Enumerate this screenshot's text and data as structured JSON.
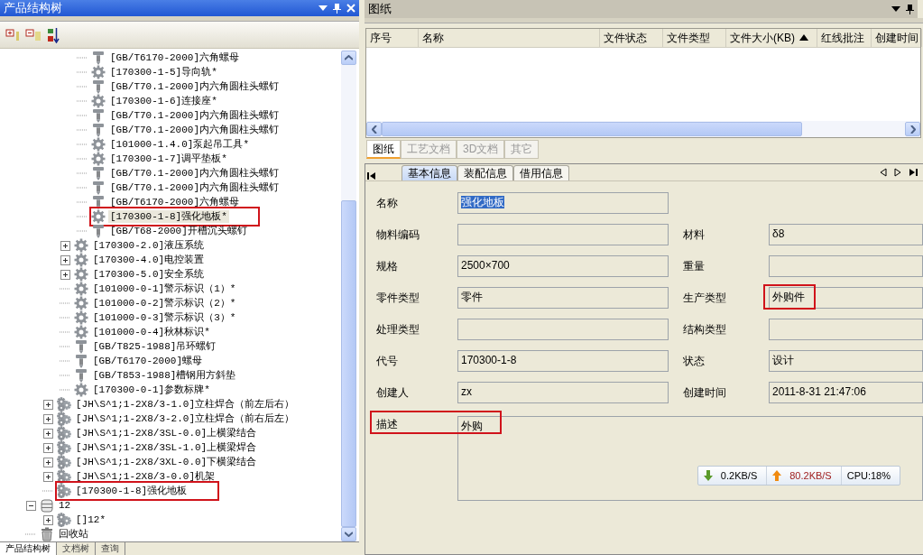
{
  "tree_panel": {
    "title": "产品结构树",
    "tree": [
      {
        "children": [
          {
            "children": [
              {
                "children": [
                  {
                    "label": "[GB/T6170-2000]六角螺母",
                    "kind": "standard",
                    "selected": false,
                    "annotated": false
                  },
                  {
                    "label": "[170300-1-5]导向轨*",
                    "kind": "part",
                    "selected": false,
                    "annotated": false
                  },
                  {
                    "label": "[GB/T70.1-2000]内六角圆柱头螺钉",
                    "kind": "standard",
                    "selected": false,
                    "annotated": false
                  },
                  {
                    "label": "[170300-1-6]连接座*",
                    "kind": "part",
                    "selected": false,
                    "annotated": false
                  },
                  {
                    "label": "[GB/T70.1-2000]内六角圆柱头螺钉",
                    "kind": "standard",
                    "selected": false,
                    "annotated": false
                  },
                  {
                    "label": "[GB/T70.1-2000]内六角圆柱头螺钉",
                    "kind": "standard",
                    "selected": false,
                    "annotated": false
                  },
                  {
                    "label": "[101000-1.4.0]泵起吊工具*",
                    "kind": "part",
                    "selected": false,
                    "annotated": false
                  },
                  {
                    "label": "[170300-1-7]调平垫板*",
                    "kind": "part",
                    "selected": false,
                    "annotated": false
                  },
                  {
                    "label": "[GB/T70.1-2000]内六角圆柱头螺钉",
                    "kind": "standard",
                    "selected": false,
                    "annotated": false
                  },
                  {
                    "label": "[GB/T70.1-2000]内六角圆柱头螺钉",
                    "kind": "standard",
                    "selected": false,
                    "annotated": false
                  },
                  {
                    "label": "[GB/T6170-2000]六角螺母",
                    "kind": "standard",
                    "selected": false,
                    "annotated": false
                  },
                  {
                    "label": "[170300-1-8]强化地板*",
                    "kind": "part",
                    "selected": true,
                    "annotated": true
                  },
                  {
                    "label": "[GB/T68-2000]开槽沉头螺钉",
                    "kind": "standard",
                    "selected": false,
                    "annotated": false
                  }
                ]
              },
              {
                "label": "[170300-2.0]液压系统",
                "kind": "part",
                "expanded": false,
                "selected": false,
                "annotated": false
              },
              {
                "label": "[170300-4.0]电控装置",
                "kind": "part",
                "expanded": false,
                "selected": false,
                "annotated": false
              },
              {
                "label": "[170300-5.0]安全系统",
                "kind": "part",
                "expanded": false,
                "selected": false,
                "annotated": false
              },
              {
                "label": "[101000-0-1]警示标识（1）*",
                "kind": "part",
                "selected": false,
                "annotated": false
              },
              {
                "label": "[101000-0-2]警示标识（2）*",
                "kind": "part",
                "selected": false,
                "annotated": false
              },
              {
                "label": "[101000-0-3]警示标识（3）*",
                "kind": "part",
                "selected": false,
                "annotated": false
              },
              {
                "label": "[101000-0-4]秋林标识*",
                "kind": "part",
                "selected": false,
                "annotated": false
              },
              {
                "label": "[GB/T825-1988]吊环螺钉",
                "kind": "standard",
                "selected": false,
                "annotated": false
              },
              {
                "label": "[GB/T6170-2000]螺母",
                "kind": "standard",
                "selected": false,
                "annotated": false
              },
              {
                "label": "[GB/T853-1988]槽钢用方斜垫",
                "kind": "standard",
                "selected": false,
                "annotated": false
              },
              {
                "label": "[170300-0-1]参数标牌*",
                "kind": "part",
                "selected": false,
                "annotated": false
              }
            ]
          },
          {
            "label": "[JH\\S^1;1-2X8/3-1.0]立柱焊合（前左后右）",
            "kind": "assembly",
            "expanded": false,
            "selected": false,
            "annotated": false
          },
          {
            "label": "[JH\\S^1;1-2X8/3-2.0]立柱焊合（前右后左）",
            "kind": "assembly",
            "expanded": false,
            "selected": false,
            "annotated": false
          },
          {
            "label": "[JH\\S^1;1-2X8/3SL-0.0]上横梁结合",
            "kind": "assembly",
            "expanded": false,
            "selected": false,
            "annotated": false
          },
          {
            "label": "[JH\\S^1;1-2X8/3SL-1.0]上横梁焊合",
            "kind": "assembly",
            "expanded": false,
            "selected": false,
            "annotated": false
          },
          {
            "label": "[JH\\S^1;1-2X8/3XL-0.0]下横梁结合",
            "kind": "assembly",
            "expanded": false,
            "selected": false,
            "annotated": false
          },
          {
            "label": "[JH\\S^1;1-2X8/3-0.0]机架",
            "kind": "assembly",
            "expanded": false,
            "selected": false,
            "annotated": false
          },
          {
            "label": "[170300-1-8]强化地板",
            "kind": "assembly",
            "selected": false,
            "annotated": true
          }
        ]
      },
      {
        "label": "12",
        "kind": "database",
        "expanded": true,
        "selected": false,
        "annotated": false,
        "children": [
          {
            "label": "[]12*",
            "kind": "assembly",
            "expanded": false,
            "selected": false,
            "annotated": false
          }
        ]
      },
      {
        "label": "回收站",
        "kind": "trash",
        "selected": false,
        "annotated": false
      }
    ],
    "bottom_tabs": [
      {
        "label": "产品结构树",
        "selected": true
      },
      {
        "label": "文档树",
        "selected": false
      },
      {
        "label": "查询",
        "selected": false
      }
    ]
  },
  "drawings_panel": {
    "title": "图纸",
    "columns": [
      {
        "label": "序号",
        "sorted": false
      },
      {
        "label": "名称",
        "sorted": false
      },
      {
        "label": "文件状态",
        "sorted": false
      },
      {
        "label": "文件类型",
        "sorted": false
      },
      {
        "label": "文件大小(KB)",
        "sorted": true
      },
      {
        "label": "红线批注",
        "sorted": false
      },
      {
        "label": "创建时间",
        "sorted": false
      }
    ],
    "tabs": [
      {
        "label": "图纸",
        "selected": true
      },
      {
        "label": "工艺文档",
        "selected": false
      },
      {
        "label": "3D文档",
        "selected": false
      },
      {
        "label": "其它",
        "selected": false
      }
    ]
  },
  "info_panel": {
    "tabs": [
      {
        "label": "基本信息",
        "selected": true
      },
      {
        "label": "装配信息",
        "selected": false
      },
      {
        "label": "借用信息",
        "selected": false
      }
    ],
    "rows": [
      [
        {
          "label": "名称",
          "value": "强化地板",
          "value_selected": true,
          "annotated": false
        }
      ],
      [
        {
          "label": "物料编码",
          "annotated": false
        },
        {
          "label": "材料",
          "value": "δ8",
          "value_selected": false,
          "annotated": false
        }
      ],
      [
        {
          "label": "规格",
          "value": "2500×700",
          "value_selected": false,
          "annotated": false
        },
        {
          "label": "重量",
          "annotated": false
        }
      ],
      [
        {
          "label": "零件类型",
          "value": "零件",
          "value_selected": false,
          "annotated": false
        },
        {
          "label": "生产类型",
          "value": "外购件",
          "value_selected": false,
          "annotated": true
        }
      ],
      [
        {
          "label": "处理类型",
          "annotated": false
        },
        {
          "label": "结构类型",
          "annotated": false
        }
      ],
      [
        {
          "label": "代号",
          "value": "170300-1-8",
          "value_selected": false,
          "annotated": false
        },
        {
          "label": "状态",
          "value": "设计",
          "value_selected": false,
          "annotated": false
        }
      ],
      [
        {
          "label": "创建人",
          "value": "zx",
          "value_selected": false,
          "annotated": false
        },
        {
          "label": "创建时间",
          "value": "2011-8-31 21:47:06",
          "value_selected": false,
          "annotated": false
        }
      ]
    ],
    "description": {
      "label": "描述",
      "value": "外购",
      "annotated": true
    }
  },
  "net_monitor": {
    "download": "0.2KB/S",
    "upload": "80.2KB/S",
    "cpu": "CPU:18%"
  }
}
